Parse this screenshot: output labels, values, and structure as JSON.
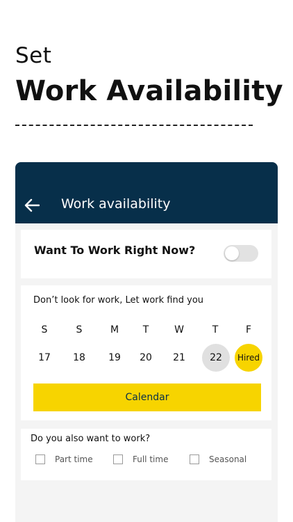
{
  "promo": {
    "set": "Set",
    "title": "Work Availability"
  },
  "app": {
    "title": "Work availability",
    "back_icon": "arrow-left-icon"
  },
  "work_now": {
    "label": "Want To Work Right Now?",
    "toggle_on": false
  },
  "schedule": {
    "label": "Don’t look for work, Let work find you",
    "weekdays": [
      "S",
      "S",
      "M",
      "T",
      "W",
      "T",
      "F"
    ],
    "dates": [
      {
        "day": "17"
      },
      {
        "day": "18"
      },
      {
        "day": "19"
      },
      {
        "day": "20"
      },
      {
        "day": "21"
      },
      {
        "day": "22",
        "state": "today"
      },
      {
        "day": "Hired",
        "state": "hired"
      }
    ],
    "calendar_button": "Calendar"
  },
  "also_work": {
    "label": "Do you also want to work?",
    "options": [
      {
        "label": "Part time",
        "checked": false
      },
      {
        "label": "Full time",
        "checked": false
      },
      {
        "label": "Seasonal",
        "checked": false
      }
    ]
  },
  "colors": {
    "appbar": "#072f4a",
    "accent_yellow": "#f7d400",
    "today_circle": "#e0e0e0",
    "screen_bg": "#f4f4f4"
  }
}
